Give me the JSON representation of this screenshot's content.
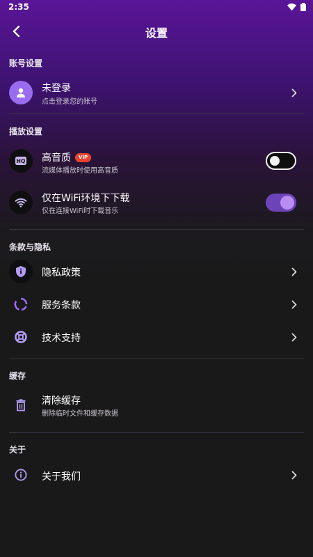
{
  "status_bar": {
    "time": "2:35"
  },
  "header": {
    "title": "设置"
  },
  "sections": {
    "account": {
      "label": "账号设置",
      "login": {
        "title": "未登录",
        "subtitle": "点击登录您的账号"
      }
    },
    "playback": {
      "label": "播放设置",
      "hq": {
        "title": "高音质",
        "badge": "VIP",
        "subtitle": "流媒体播放时使用高音质",
        "enabled": false
      },
      "wifi": {
        "title": "仅在WiFi环境下下载",
        "subtitle": "仅在连接WiFi时下载音乐",
        "enabled": true
      }
    },
    "terms": {
      "label": "条款与隐私",
      "privacy": {
        "title": "隐私政策"
      },
      "service": {
        "title": "服务条款"
      },
      "support": {
        "title": "技术支持"
      }
    },
    "cache": {
      "label": "缓存",
      "clear": {
        "title": "清除缓存",
        "subtitle": "删除临时文件和缓存数据"
      }
    },
    "about": {
      "label": "关于",
      "about_us": {
        "title": "关于我们"
      }
    }
  },
  "colors": {
    "accent": "#9b6bf0",
    "badge": "#e8432f",
    "background": "#191919"
  }
}
